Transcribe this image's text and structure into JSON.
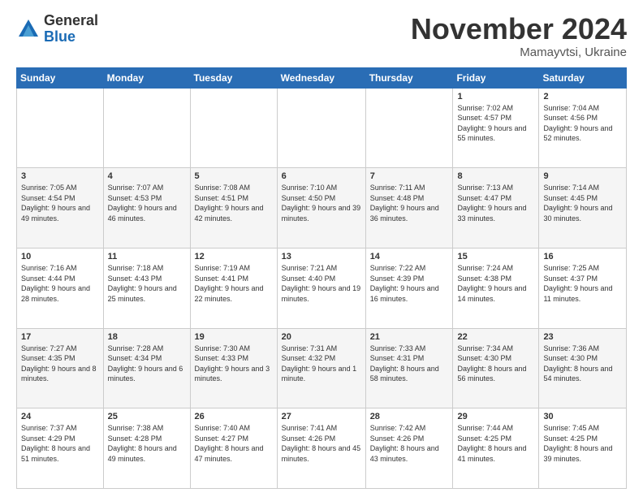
{
  "logo": {
    "general": "General",
    "blue": "Blue"
  },
  "title": "November 2024",
  "location": "Mamayvtsi, Ukraine",
  "weekdays": [
    "Sunday",
    "Monday",
    "Tuesday",
    "Wednesday",
    "Thursday",
    "Friday",
    "Saturday"
  ],
  "weeks": [
    [
      {
        "day": "",
        "info": ""
      },
      {
        "day": "",
        "info": ""
      },
      {
        "day": "",
        "info": ""
      },
      {
        "day": "",
        "info": ""
      },
      {
        "day": "",
        "info": ""
      },
      {
        "day": "1",
        "info": "Sunrise: 7:02 AM\nSunset: 4:57 PM\nDaylight: 9 hours and 55 minutes."
      },
      {
        "day": "2",
        "info": "Sunrise: 7:04 AM\nSunset: 4:56 PM\nDaylight: 9 hours and 52 minutes."
      }
    ],
    [
      {
        "day": "3",
        "info": "Sunrise: 7:05 AM\nSunset: 4:54 PM\nDaylight: 9 hours and 49 minutes."
      },
      {
        "day": "4",
        "info": "Sunrise: 7:07 AM\nSunset: 4:53 PM\nDaylight: 9 hours and 46 minutes."
      },
      {
        "day": "5",
        "info": "Sunrise: 7:08 AM\nSunset: 4:51 PM\nDaylight: 9 hours and 42 minutes."
      },
      {
        "day": "6",
        "info": "Sunrise: 7:10 AM\nSunset: 4:50 PM\nDaylight: 9 hours and 39 minutes."
      },
      {
        "day": "7",
        "info": "Sunrise: 7:11 AM\nSunset: 4:48 PM\nDaylight: 9 hours and 36 minutes."
      },
      {
        "day": "8",
        "info": "Sunrise: 7:13 AM\nSunset: 4:47 PM\nDaylight: 9 hours and 33 minutes."
      },
      {
        "day": "9",
        "info": "Sunrise: 7:14 AM\nSunset: 4:45 PM\nDaylight: 9 hours and 30 minutes."
      }
    ],
    [
      {
        "day": "10",
        "info": "Sunrise: 7:16 AM\nSunset: 4:44 PM\nDaylight: 9 hours and 28 minutes."
      },
      {
        "day": "11",
        "info": "Sunrise: 7:18 AM\nSunset: 4:43 PM\nDaylight: 9 hours and 25 minutes."
      },
      {
        "day": "12",
        "info": "Sunrise: 7:19 AM\nSunset: 4:41 PM\nDaylight: 9 hours and 22 minutes."
      },
      {
        "day": "13",
        "info": "Sunrise: 7:21 AM\nSunset: 4:40 PM\nDaylight: 9 hours and 19 minutes."
      },
      {
        "day": "14",
        "info": "Sunrise: 7:22 AM\nSunset: 4:39 PM\nDaylight: 9 hours and 16 minutes."
      },
      {
        "day": "15",
        "info": "Sunrise: 7:24 AM\nSunset: 4:38 PM\nDaylight: 9 hours and 14 minutes."
      },
      {
        "day": "16",
        "info": "Sunrise: 7:25 AM\nSunset: 4:37 PM\nDaylight: 9 hours and 11 minutes."
      }
    ],
    [
      {
        "day": "17",
        "info": "Sunrise: 7:27 AM\nSunset: 4:35 PM\nDaylight: 9 hours and 8 minutes."
      },
      {
        "day": "18",
        "info": "Sunrise: 7:28 AM\nSunset: 4:34 PM\nDaylight: 9 hours and 6 minutes."
      },
      {
        "day": "19",
        "info": "Sunrise: 7:30 AM\nSunset: 4:33 PM\nDaylight: 9 hours and 3 minutes."
      },
      {
        "day": "20",
        "info": "Sunrise: 7:31 AM\nSunset: 4:32 PM\nDaylight: 9 hours and 1 minute."
      },
      {
        "day": "21",
        "info": "Sunrise: 7:33 AM\nSunset: 4:31 PM\nDaylight: 8 hours and 58 minutes."
      },
      {
        "day": "22",
        "info": "Sunrise: 7:34 AM\nSunset: 4:30 PM\nDaylight: 8 hours and 56 minutes."
      },
      {
        "day": "23",
        "info": "Sunrise: 7:36 AM\nSunset: 4:30 PM\nDaylight: 8 hours and 54 minutes."
      }
    ],
    [
      {
        "day": "24",
        "info": "Sunrise: 7:37 AM\nSunset: 4:29 PM\nDaylight: 8 hours and 51 minutes."
      },
      {
        "day": "25",
        "info": "Sunrise: 7:38 AM\nSunset: 4:28 PM\nDaylight: 8 hours and 49 minutes."
      },
      {
        "day": "26",
        "info": "Sunrise: 7:40 AM\nSunset: 4:27 PM\nDaylight: 8 hours and 47 minutes."
      },
      {
        "day": "27",
        "info": "Sunrise: 7:41 AM\nSunset: 4:26 PM\nDaylight: 8 hours and 45 minutes."
      },
      {
        "day": "28",
        "info": "Sunrise: 7:42 AM\nSunset: 4:26 PM\nDaylight: 8 hours and 43 minutes."
      },
      {
        "day": "29",
        "info": "Sunrise: 7:44 AM\nSunset: 4:25 PM\nDaylight: 8 hours and 41 minutes."
      },
      {
        "day": "30",
        "info": "Sunrise: 7:45 AM\nSunset: 4:25 PM\nDaylight: 8 hours and 39 minutes."
      }
    ]
  ]
}
